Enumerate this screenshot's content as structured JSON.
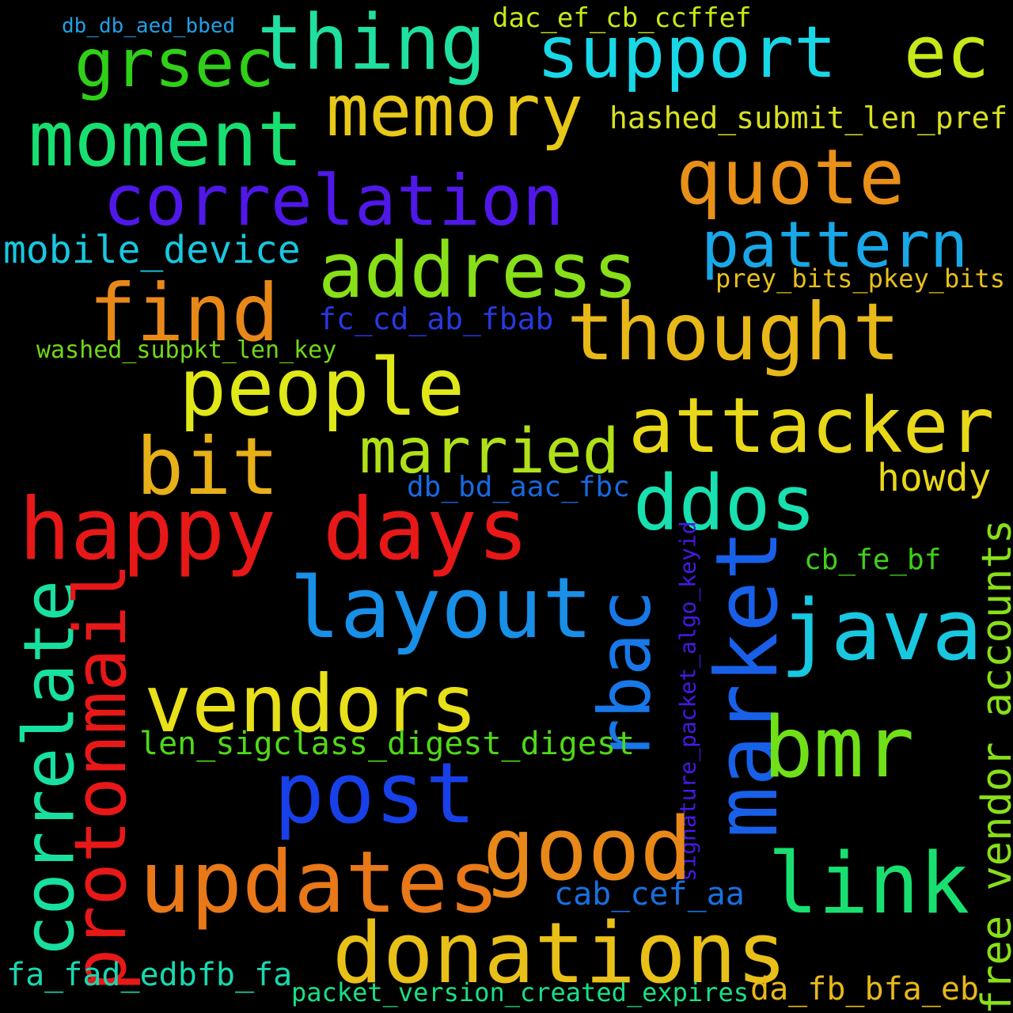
{
  "words": [
    {
      "text": "db_db_aed_bbed",
      "color": "#1fa0e6"
    },
    {
      "text": "thing",
      "color": "#1fe0a0"
    },
    {
      "text": "support",
      "color": "#18d8e8"
    },
    {
      "text": "ec",
      "color": "#c8e818"
    },
    {
      "text": "dac_ef_cb_ccffef",
      "color": "#c8e818"
    },
    {
      "text": "grsec",
      "color": "#30d018"
    },
    {
      "text": "memory",
      "color": "#e8c818"
    },
    {
      "text": "hashed_submit_len_pref",
      "color": "#d8e020"
    },
    {
      "text": "moment",
      "color": "#18e070"
    },
    {
      "text": "quote",
      "color": "#e89018"
    },
    {
      "text": "correlation",
      "color": "#5018e8"
    },
    {
      "text": "pattern",
      "color": "#18a8e8"
    },
    {
      "text": "mobile_device",
      "color": "#18c8e0"
    },
    {
      "text": "address",
      "color": "#88e018"
    },
    {
      "text": "prey_bits_pkey_bits",
      "color": "#e8c018"
    },
    {
      "text": "find",
      "color": "#e88818"
    },
    {
      "text": "fc_cd_ab_fbab",
      "color": "#2838e0"
    },
    {
      "text": "thought",
      "color": "#e8b818"
    },
    {
      "text": "washed_subpkt_len_key",
      "color": "#70d818"
    },
    {
      "text": "people",
      "color": "#e0e818"
    },
    {
      "text": "attacker",
      "color": "#e8d818"
    },
    {
      "text": "married",
      "color": "#b0e018"
    },
    {
      "text": "bit",
      "color": "#e8b018"
    },
    {
      "text": "howdy",
      "color": "#e8d818"
    },
    {
      "text": "db_bd_aac_fbc",
      "color": "#1868e0"
    },
    {
      "text": "ddos",
      "color": "#18e0b0"
    },
    {
      "text": "happy",
      "color": "#e81818"
    },
    {
      "text": "days",
      "color": "#e81818"
    },
    {
      "text": "cb_fe_bf",
      "color": "#40d018"
    },
    {
      "text": "layout",
      "color": "#1890e8"
    },
    {
      "text": "java",
      "color": "#18c8e0"
    },
    {
      "text": "rbac",
      "color": "#1878e8"
    },
    {
      "text": "market",
      "color": "#1860e8"
    },
    {
      "text": "signature_packet_algo_keyid",
      "color": "#4818e8"
    },
    {
      "text": "correlate",
      "color": "#18e0a0"
    },
    {
      "text": "protonmail",
      "color": "#e81818"
    },
    {
      "text": "free_vendor_accounts",
      "color": "#88e018"
    },
    {
      "text": "vendors",
      "color": "#e8e018"
    },
    {
      "text": "bmr",
      "color": "#70e018"
    },
    {
      "text": "len_sigclass_digest_digest",
      "color": "#50d818"
    },
    {
      "text": "post",
      "color": "#1840e8"
    },
    {
      "text": "good",
      "color": "#e88818"
    },
    {
      "text": "updates",
      "color": "#e87818"
    },
    {
      "text": "link",
      "color": "#18e070"
    },
    {
      "text": "cab_cef_aa",
      "color": "#1870e0"
    },
    {
      "text": "donations",
      "color": "#e8c018"
    },
    {
      "text": "fa_fad_edbfb_fa",
      "color": "#18d8b0"
    },
    {
      "text": "packet_version_created_expires",
      "color": "#18e088"
    },
    {
      "text": "da_fb_bfa_eb",
      "color": "#e8b818"
    }
  ]
}
